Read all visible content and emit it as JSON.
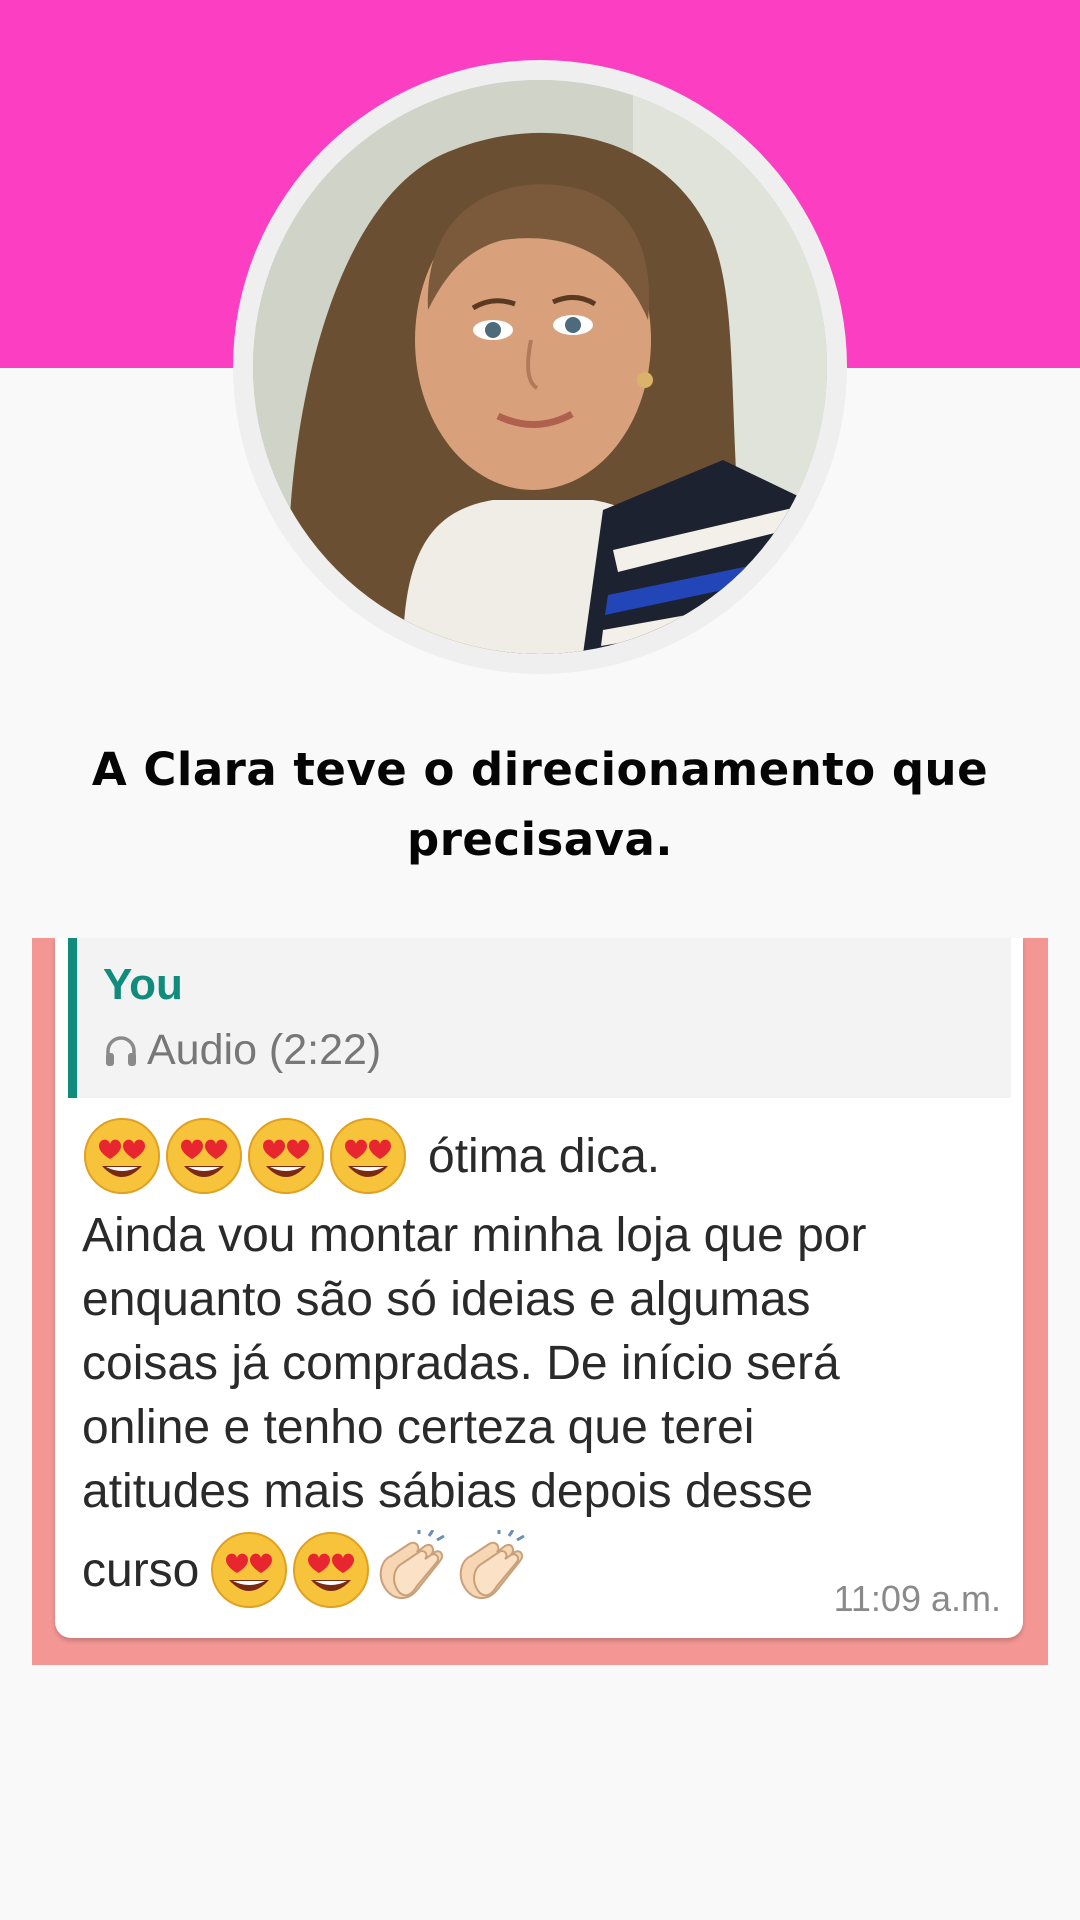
{
  "header": {
    "band_color": "#fc3ec3",
    "avatar_description_icon": "profile-photo"
  },
  "headline": {
    "line1": "A Clara teve o direcionamento que",
    "line2": "precisava."
  },
  "chat": {
    "frame_color": "#f49694",
    "accent_color": "#0f8c7b",
    "quote": {
      "sender": "You",
      "audio_label": "Audio (2:22)",
      "icon": "headphones-icon"
    },
    "message": {
      "first_line_text": "ótima dica.",
      "body_lines": [
        "Ainda vou montar minha loja que por",
        "enquanto são só ideias e algumas",
        "coisas já compradas. De início será",
        "online e tenho certeza que terei",
        "atitudes mais sábias depois desse"
      ],
      "last_line_text": "curso",
      "leading_emojis": [
        "heart-eyes-emoji",
        "heart-eyes-emoji",
        "heart-eyes-emoji",
        "heart-eyes-emoji"
      ],
      "trailing_emojis": [
        "heart-eyes-emoji",
        "heart-eyes-emoji",
        "clapping-hands-emoji",
        "clapping-hands-emoji"
      ]
    },
    "timestamp": "11:09 a.m."
  }
}
